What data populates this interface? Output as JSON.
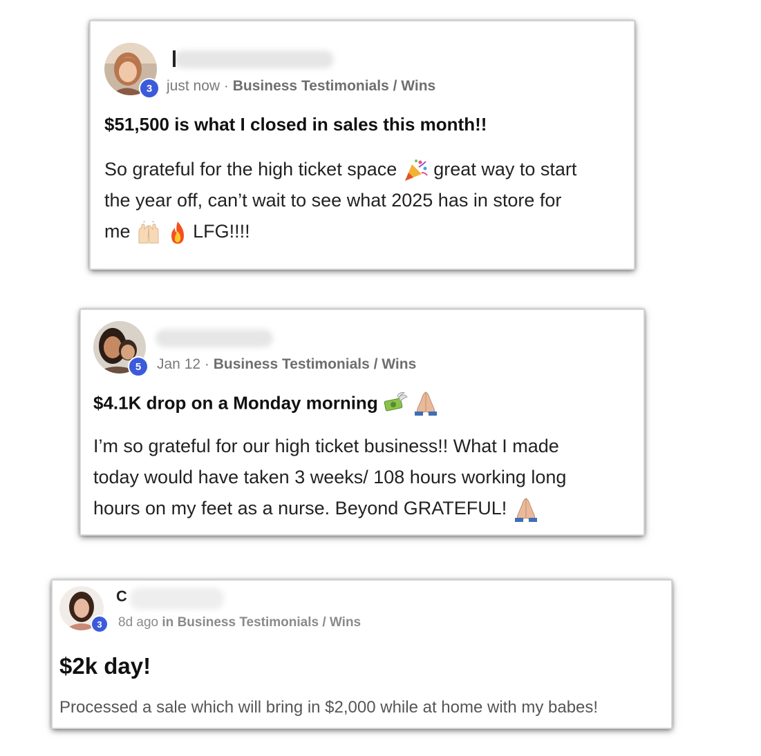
{
  "posts": [
    {
      "level": "3",
      "time": "just now",
      "separator": "·",
      "category": "Business Testimonials / Wins",
      "title": "$51,500 is what I closed in sales this month!!",
      "body_part1": "So grateful for the high ticket space",
      "body_part2": "great way to start",
      "body_line2": "the year off, can’t wait to see what 2025 has in store for",
      "body_line3_start": "me",
      "body_line3_end": "LFG!!!!",
      "emojis": [
        "party-popper-icon",
        "raising-hands-icon",
        "fire-icon"
      ]
    },
    {
      "level": "5",
      "time": "Jan 12",
      "separator": "·",
      "category": "Business Testimonials / Wins",
      "title": "$4.1K drop on a Monday morning",
      "body_line1": "I’m so grateful for our high ticket business!! What I made",
      "body_line2": "today would have taken 3 weeks/ 108 hours working long",
      "body_line3": "hours on my feet as a nurse. Beyond GRATEFUL!",
      "emojis": [
        "money-with-wings-icon",
        "folded-hands-icon",
        "folded-hands-icon"
      ]
    },
    {
      "level": "3",
      "name_initial": "C",
      "time": "8d ago",
      "meta_rest": "in Business Testimonials / Wins",
      "title": "$2k day!",
      "body": "Processed a sale which will bring in $2,000 while at home with my babes!"
    }
  ],
  "colors": {
    "badge": "#3b5bdb",
    "meta_text": "#7a7a7a",
    "title_text": "#111111"
  }
}
